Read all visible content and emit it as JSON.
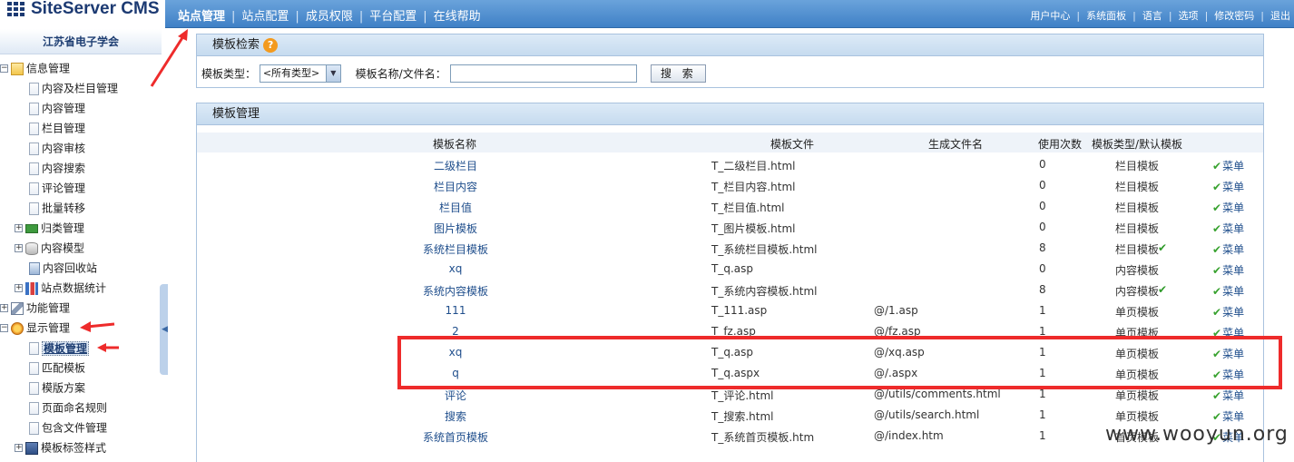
{
  "app": {
    "logo_text": "SiteServer CMS"
  },
  "topnav": {
    "items": [
      "站点管理",
      "站点配置",
      "成员权限",
      "平台配置",
      "在线帮助"
    ],
    "separator": "|"
  },
  "userlinks": {
    "items": [
      "用户中心",
      "系统面板",
      "语言",
      "选项",
      "修改密码",
      "退出"
    ],
    "separator": "|"
  },
  "sidebar": {
    "site_name": "江苏省电子学会",
    "tree": [
      {
        "label": "信息管理",
        "expander": "⊟",
        "icon": "folder-info-icon"
      },
      {
        "label": "内容及栏目管理",
        "icon": "document-icon"
      },
      {
        "label": "内容管理",
        "icon": "document-icon"
      },
      {
        "label": "栏目管理",
        "icon": "document-icon"
      },
      {
        "label": "内容审核",
        "icon": "document-icon"
      },
      {
        "label": "内容搜索",
        "icon": "document-icon"
      },
      {
        "label": "评论管理",
        "icon": "document-icon"
      },
      {
        "label": "批量转移",
        "icon": "document-icon"
      },
      {
        "label": "归类管理",
        "expander": "⊞",
        "icon": "hierarchy-icon"
      },
      {
        "label": "内容模型",
        "expander": "⊞",
        "icon": "database-icon"
      },
      {
        "label": "内容回收站",
        "icon": "recycle-bin-icon"
      },
      {
        "label": "站点数据统计",
        "expander": "⊞",
        "icon": "bar-chart-icon"
      },
      {
        "label": "功能管理",
        "expander": "⊞",
        "icon": "wrench-icon"
      },
      {
        "label": "显示管理",
        "expander": "⊟",
        "icon": "display-icon"
      },
      {
        "label": "模板管理",
        "icon": "document-icon",
        "selected": true
      },
      {
        "label": "匹配模板",
        "icon": "document-icon"
      },
      {
        "label": "模版方案",
        "icon": "document-icon"
      },
      {
        "label": "页面命名规则",
        "icon": "document-icon"
      },
      {
        "label": "包含文件管理",
        "icon": "document-icon"
      },
      {
        "label": "模板标签样式",
        "expander": "⊞",
        "icon": "book-icon"
      }
    ]
  },
  "search_panel": {
    "title": "模板检索",
    "help_icon": "?",
    "type_label": "模板类型：",
    "type_value": "<所有类型>",
    "name_label": "模板名称/文件名：",
    "name_value": "",
    "search_button": "搜 索"
  },
  "manage_panel": {
    "title": "模板管理",
    "columns": [
      "模板名称",
      "模板文件",
      "生成文件名",
      "使用次数",
      "模板类型/默认模板"
    ],
    "menu_label": "菜单",
    "rows": [
      {
        "name": "二级栏目",
        "file": "T_二级栏目.html",
        "generated": "",
        "count": "0",
        "type": "栏目模板",
        "default": false
      },
      {
        "name": "栏目内容",
        "file": "T_栏目内容.html",
        "generated": "",
        "count": "0",
        "type": "栏目模板",
        "default": false
      },
      {
        "name": "栏目值",
        "file": "T_栏目值.html",
        "generated": "",
        "count": "0",
        "type": "栏目模板",
        "default": false
      },
      {
        "name": "图片模板",
        "file": "T_图片模板.html",
        "generated": "",
        "count": "0",
        "type": "栏目模板",
        "default": false
      },
      {
        "name": "系统栏目模板",
        "file": "T_系统栏目模板.html",
        "generated": "",
        "count": "8",
        "type": "栏目模板",
        "default": true
      },
      {
        "name": "xq",
        "file": "T_q.asp",
        "generated": "",
        "count": "0",
        "type": "内容模板",
        "default": false
      },
      {
        "name": "系统内容模板",
        "file": "T_系统内容模板.html",
        "generated": "",
        "count": "8",
        "type": "内容模板",
        "default": true
      },
      {
        "name": "111",
        "file": "T_111.asp",
        "generated": "@/1.asp",
        "count": "1",
        "type": "单页模板",
        "default": false
      },
      {
        "name": "2",
        "file": "T_fz.asp",
        "generated": "@/fz.asp",
        "count": "1",
        "type": "单页模板",
        "default": false
      },
      {
        "name": "xq",
        "file": "T_q.asp",
        "generated": "@/xq.asp",
        "count": "1",
        "type": "单页模板",
        "default": false
      },
      {
        "name": "q",
        "file": "T_q.aspx",
        "generated": "@/.aspx",
        "count": "1",
        "type": "单页模板",
        "default": false
      },
      {
        "name": "评论",
        "file": "T_评论.html",
        "generated": "@/utils/comments.html",
        "count": "1",
        "type": "单页模板",
        "default": false
      },
      {
        "name": "搜索",
        "file": "T_搜索.html",
        "generated": "@/utils/search.html",
        "count": "1",
        "type": "单页模板",
        "default": false
      },
      {
        "name": "系统首页模板",
        "file": "T_系统首页模板.htm",
        "generated": "@/index.htm",
        "count": "1",
        "type": "首页模板",
        "default": false
      }
    ]
  },
  "watermark": "www.wooyun.org",
  "colors": {
    "topbar": "#4a8ad0",
    "annotation_red": "#ee2b2b",
    "check_green": "#38a22f",
    "link_blue": "#1f4e8c"
  }
}
